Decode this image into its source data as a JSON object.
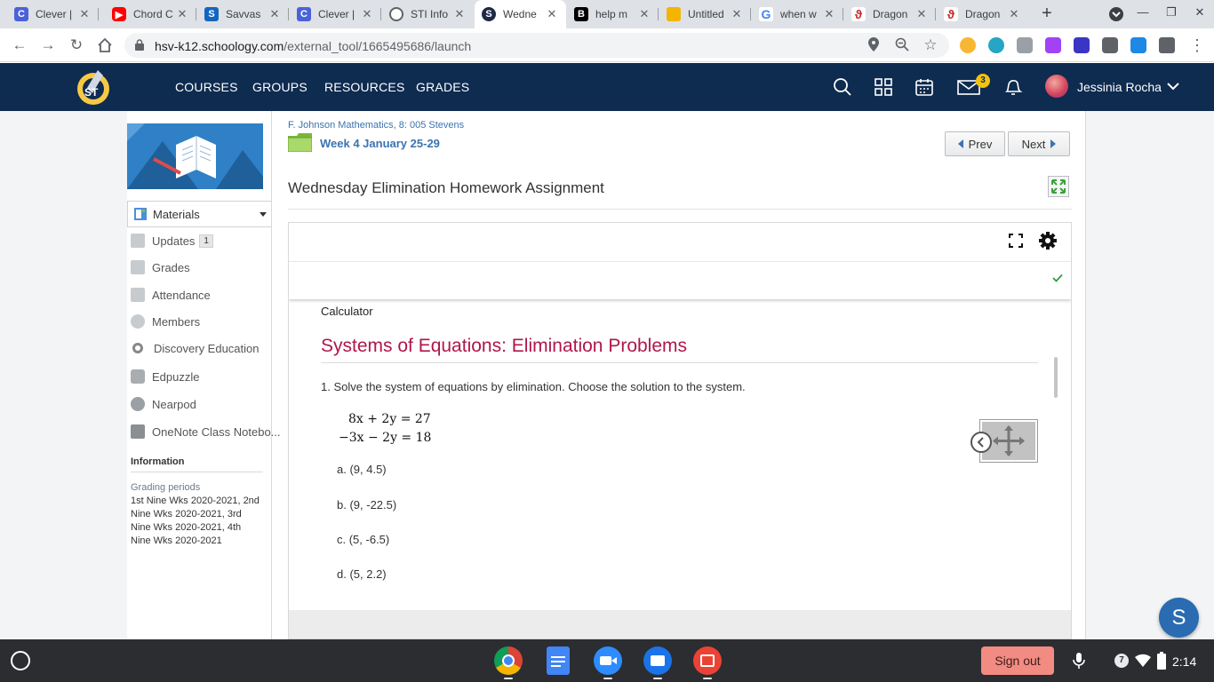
{
  "browser": {
    "tabs": [
      {
        "title": "Clever |",
        "icon": "clever-icon",
        "color": "#4a62d8"
      },
      {
        "title": "Chord C",
        "icon": "youtube-icon",
        "color": "#ff0000"
      },
      {
        "title": "Savvas",
        "icon": "savvas-icon",
        "color": "#1565c0"
      },
      {
        "title": "Clever |",
        "icon": "clever-icon",
        "color": "#4a62d8"
      },
      {
        "title": "STI Info",
        "icon": "globe-icon",
        "color": "#5f6368"
      },
      {
        "title": "Wedne",
        "icon": "schoology-icon",
        "color": "#1f2a44"
      },
      {
        "title": "help m",
        "icon": "brainly-icon",
        "color": "#000000"
      },
      {
        "title": "Untitled",
        "icon": "slides-icon",
        "color": "#f4b400"
      },
      {
        "title": "when w",
        "icon": "google-icon",
        "color": "#4285f4"
      },
      {
        "title": "Dragon",
        "icon": "dragon-icon",
        "color": "#c62828"
      },
      {
        "title": "Dragon",
        "icon": "dragon-icon",
        "color": "#c62828"
      }
    ],
    "url_host": "hsv-k12.schoology.com",
    "url_path": "/external_tool/1665495686/launch"
  },
  "header": {
    "nav": [
      "COURSES",
      "GROUPS",
      "RESOURCES",
      "GRADES"
    ],
    "mail_badge": "3",
    "user_name": "Jessinia Rocha",
    "bg_color": "#0e2b50"
  },
  "sidebar": {
    "materials_label": "Materials",
    "items": [
      {
        "label": "Updates",
        "count": "1",
        "icon": "updates-icon"
      },
      {
        "label": "Grades",
        "icon": "grades-icon"
      },
      {
        "label": "Attendance",
        "icon": "attendance-icon"
      },
      {
        "label": "Members",
        "icon": "members-icon"
      },
      {
        "label": "Discovery Education",
        "icon": "discovery-education-icon"
      },
      {
        "label": "Edpuzzle",
        "icon": "edpuzzle-icon"
      },
      {
        "label": "Nearpod",
        "icon": "nearpod-icon"
      },
      {
        "label": "OneNote Class Notebo...",
        "icon": "onenote-icon"
      }
    ],
    "info_title": "Information",
    "grading_label": "Grading periods",
    "grading_lines": [
      "1st Nine Wks 2020-2021, 2nd",
      "Nine Wks 2020-2021, 3rd",
      "Nine Wks 2020-2021, 4th",
      "Nine Wks 2020-2021"
    ]
  },
  "content": {
    "breadcrumb": "F. Johnson Mathematics, 8: 005 Stevens",
    "folder": "Week 4 January 25-29",
    "prev_label": "Prev",
    "next_label": "Next",
    "assignment_title": "Wednesday Elimination Homework Assignment",
    "calculator_label": "Calculator",
    "problem_title": "Systems of Equations: Elimination Problems",
    "question": "1. Solve the system of equations by elimination. Choose the solution to the system.",
    "equations": [
      "8x + 2y = 27",
      "−3x − 2y = 18"
    ],
    "choices": [
      "a. (9, 4.5)",
      "b. (9, -22.5)",
      "c. (5, -6.5)",
      "d. (5, 2.2)"
    ],
    "title_color": "#b1164a"
  },
  "fab_label": "S",
  "shelf": {
    "signout_label": "Sign out",
    "notif_count": "7",
    "time": "2:14",
    "apps": [
      "chrome-icon",
      "docs-icon",
      "zoom-icon",
      "files-icon",
      "gallery-icon"
    ]
  }
}
